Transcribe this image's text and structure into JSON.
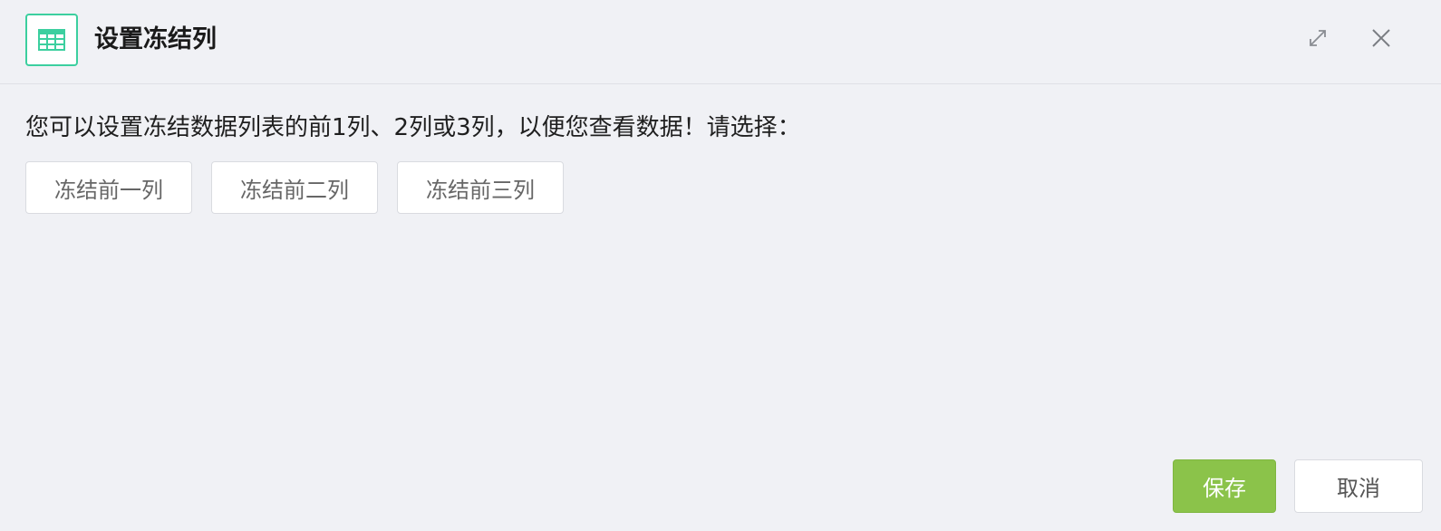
{
  "dialog": {
    "title": "设置冻结列",
    "title_icon": "table-icon",
    "maximize_icon": "maximize-icon",
    "close_icon": "close-icon"
  },
  "content": {
    "prompt": "您可以设置冻结数据列表的前1列、2列或3列，以便您查看数据！请选择：",
    "options": [
      {
        "label": "冻结前一列"
      },
      {
        "label": "冻结前二列"
      },
      {
        "label": "冻结前三列"
      }
    ]
  },
  "footer": {
    "save_label": "保存",
    "cancel_label": "取消"
  },
  "colors": {
    "accent_icon": "#3ccf9f",
    "save_button": "#8bc34a",
    "background": "#f0f1f5"
  }
}
